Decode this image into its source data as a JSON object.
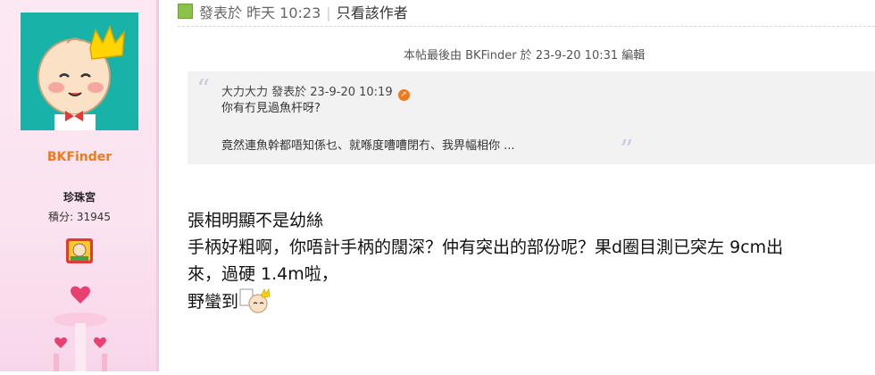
{
  "author": {
    "username": "BKFinder",
    "rank": "珍珠宮",
    "credits": "積分: 31945",
    "avatar_icon": "baby-king-avatar",
    "medal_icon": "medal-badge-icon",
    "accent": "#f07a1a"
  },
  "post": {
    "posted_label": "發表於 昨天 10:23",
    "only_author_label": "只看該作者",
    "edited_note": "本帖最後由 BKFinder 於 23-9-20 10:31 編輯"
  },
  "quote": {
    "header": "大力大力 發表於 23-9-20 10:19",
    "jump_icon": "jump-to-post-icon",
    "line1": "你有冇見過魚杆呀?",
    "line2": "竟然連魚幹都唔知係乜、就喺度嘈嘈閉冇、我畀幅相你 ..."
  },
  "content": {
    "line1": "張相明顯不是幼絲",
    "line2": "手柄好粗啊，你唔計手柄的闊深？仲有突出的部份呢？果d圈目測已突左 9cm出",
    "line3": "來，過硬 1.4m啦，",
    "line4": "野蠻到",
    "smiley_icon": "baby-king-smiley-icon"
  }
}
